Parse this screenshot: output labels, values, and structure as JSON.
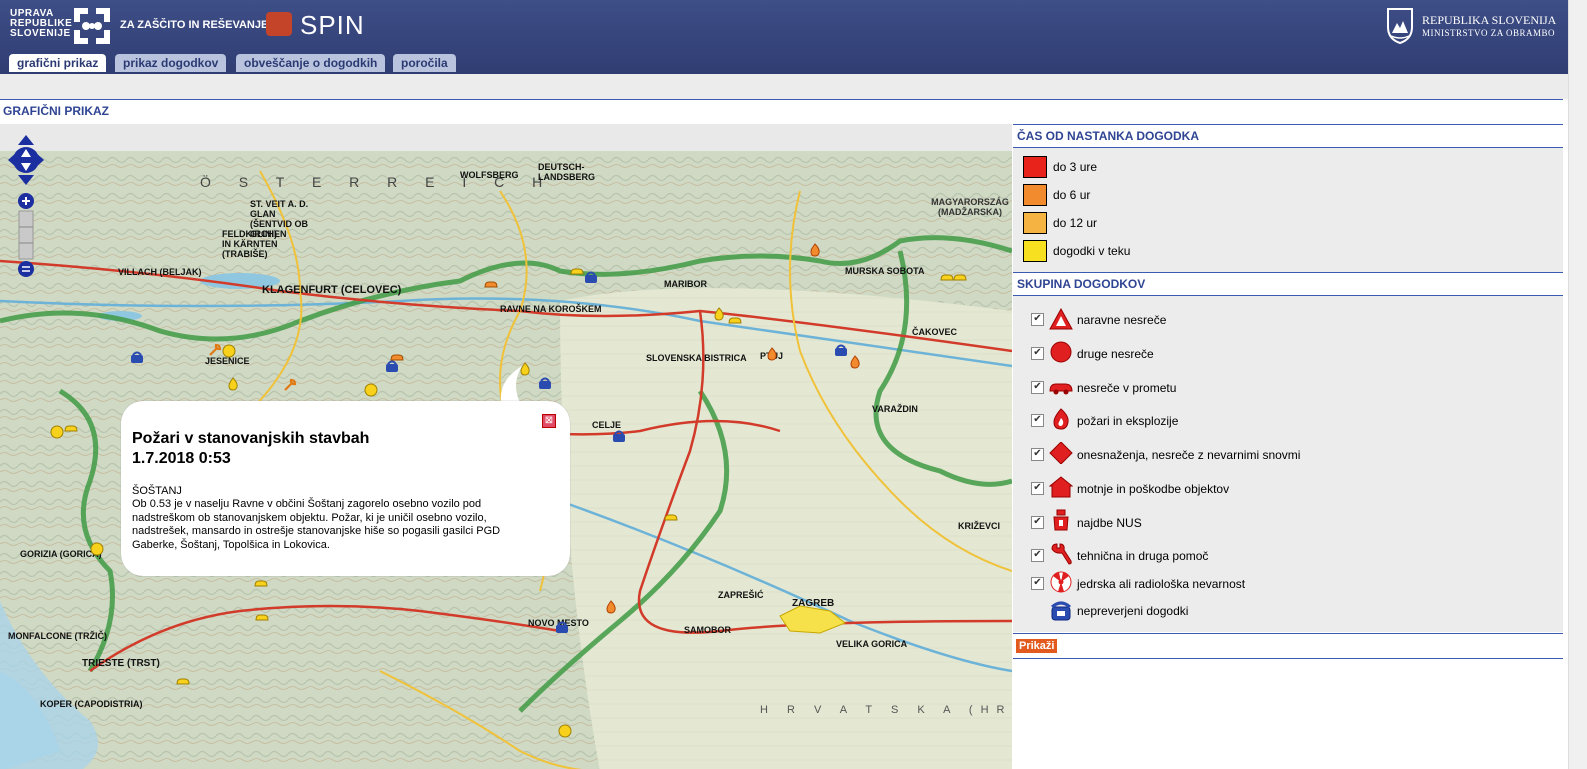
{
  "header": {
    "agency_lines": [
      "UPRAVA",
      "REPUBLIKE",
      "SLOVENIJE"
    ],
    "agency_tail": "ZA ZAŠČITO IN REŠEVANJE",
    "app_name": "SPIN",
    "ministry_line1": "REPUBLIKA SLOVENIJA",
    "ministry_line2": "MINISTRSTVO ZA OBRAMBO"
  },
  "tabs": [
    {
      "label": "grafični prikaz",
      "active": true
    },
    {
      "label": "prikaz dogodkov",
      "active": false
    },
    {
      "label": "obveščanje o dogodkih",
      "active": false
    },
    {
      "label": "poročila",
      "active": false
    }
  ],
  "page_title": "GRAFIČNI PRIKAZ",
  "map": {
    "labels": {
      "country_at": "Ö S T E R R E I C H",
      "country_hu": "MAGYARORSZÁG (MADŽARSKA)",
      "region_hr": "H R V A T S K A (HRVAŠKA)",
      "klagenfurt": "KLAGENFURT (CELOVEC)",
      "villach": "VILLACH (BELJAK)",
      "maribor": "MARIBOR",
      "celje": "CELJE",
      "zagreb": "ZAGREB",
      "trieste": "TRIESTE (TRST)",
      "koper": "KOPER (CAPODISTRIA)",
      "ptuj": "PTUJ",
      "jesenice": "JESENICE",
      "murska": "MURSKA SOBOTA",
      "varazdin": "VARAŽDIN",
      "novo_mesto": "NOVO MESTO",
      "gorizia": "GORIZIA (GORICA)",
      "krizevci": "KRIŽEVCI",
      "cakovec": "ČAKOVEC",
      "ravne": "RAVNE NA KOROŠKEM",
      "slovenska_bistrica": "SLOVENSKA BISTRICA",
      "samobor": "SAMOBOR",
      "velika_gorica": "VELIKA GORICA",
      "monfalcone": "MONFALCONE (TRŽIČ)",
      "zapresic": "ZAPREŠIĆ",
      "wolfsberg": "WOLFSBERG",
      "deutschlandsberg": "DEUTSCH-LANDSBERG",
      "st_veit": "ST. VEIT A. D. GLAN (ŠENTVID OB GLINI)",
      "feldkirchen": "FELDKIRCHEN IN KÄRNTEN (TRABIŠE)"
    }
  },
  "popup": {
    "title_line1": "Požari v stanovanjskih stavbah",
    "title_line2": "1.7.2018 0:53",
    "place": "ŠOŠTANJ",
    "text": "Ob 0.53 je v naselju Ravne v občini Šoštanj zagorelo osebno vozilo pod nadstreškom ob stanovanjskem objektu. Požar, ki je uničil osebno vozilo, nadstrešek, mansardo in ostrešje stanovanjske hiše so pogasili gasilci PGD Gaberke, Šoštanj, Topolšica in Lokovica.",
    "close_symbol": "⊠"
  },
  "panel": {
    "time_title": "ČAS OD NASTANKA DOGODKA",
    "time_items": [
      {
        "label": "do 3 ure",
        "color": "#e8231c"
      },
      {
        "label": "do 6 ur",
        "color": "#f28a2e"
      },
      {
        "label": "do 12 ur",
        "color": "#f5b342"
      },
      {
        "label": "dogodki v teku",
        "color": "#f7e01f"
      }
    ],
    "group_title": "SKUPINA DOGODKOV",
    "group_items": [
      {
        "label": "naravne nesreče",
        "icon": "natural-disaster-icon",
        "checked": true
      },
      {
        "label": "druge nesreče",
        "icon": "other-accident-icon",
        "checked": true
      },
      {
        "label": "nesreče v prometu",
        "icon": "traffic-accident-icon",
        "checked": true
      },
      {
        "label": "požari in eksplozije",
        "icon": "fire-icon",
        "checked": true
      },
      {
        "label": "onesnaženja, nesreče z nevarnimi snovmi",
        "icon": "hazmat-icon",
        "checked": true
      },
      {
        "label": "motnje in poškodbe objektov",
        "icon": "building-damage-icon",
        "checked": true
      },
      {
        "label": "najdbe NUS",
        "icon": "ordnance-icon",
        "checked": true
      },
      {
        "label": "tehnična in druga pomoč",
        "icon": "wrench-icon",
        "checked": true
      },
      {
        "label": "jedrska ali radiološka nevarnost",
        "icon": "radiation-icon",
        "checked": true
      },
      {
        "label": "nepreverjeni dogodki",
        "icon": "phone-icon",
        "checked": false
      }
    ],
    "show_button": "Prikaži",
    "check_mark": "✔"
  },
  "colors": {
    "header_bg": "#35437a",
    "accent": "#2f4593",
    "button": "#e35a1e"
  }
}
